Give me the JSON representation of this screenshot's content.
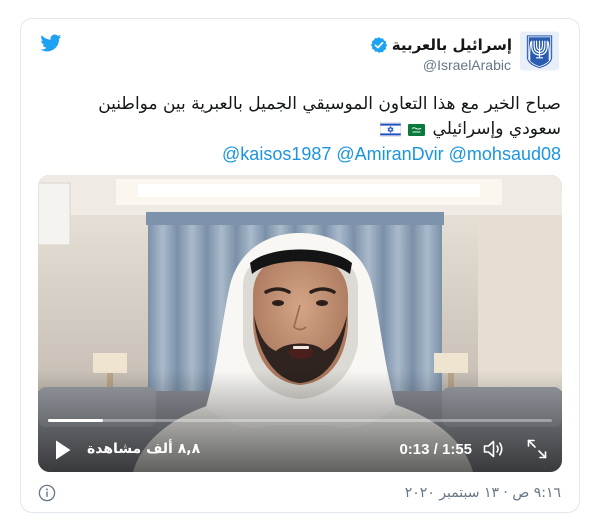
{
  "tweet": {
    "author_name": "إسرائيل بالعربية",
    "author_handle": "@IsraelArabic",
    "text_line1": "صباح الخير مع هذا التعاون الموسيقي الجميل بالعبرية بين مواطنين",
    "text_line2": "سعودي وإسرائيلي",
    "text_line2_flags": [
      "saudi-arabia-flag-icon",
      "israel-flag-icon"
    ],
    "mentions": [
      "@kaisos1987",
      "@AmiranDvir",
      "@mohsaud08"
    ],
    "timestamp": "٩:١٦ ص · ١٣ سبتمبر ٢٠٢٠"
  },
  "video": {
    "views": "٨,٨ ألف مشاهدة",
    "time": "0:13 / 1:55",
    "progress": 0.11
  },
  "icons": {
    "brand": "twitter-bird-icon",
    "avatar": "israel-emblem-icon",
    "verified": "verified-badge-icon",
    "play": "play-icon",
    "volume": "volume-icon",
    "fullscreen": "fullscreen-icon",
    "info": "info-icon"
  },
  "colors": {
    "brand_blue": "#1da1f2",
    "link_blue": "#1b95e0",
    "text_primary": "#14171a",
    "text_secondary": "#657786",
    "card_border": "#e1e8ed"
  }
}
